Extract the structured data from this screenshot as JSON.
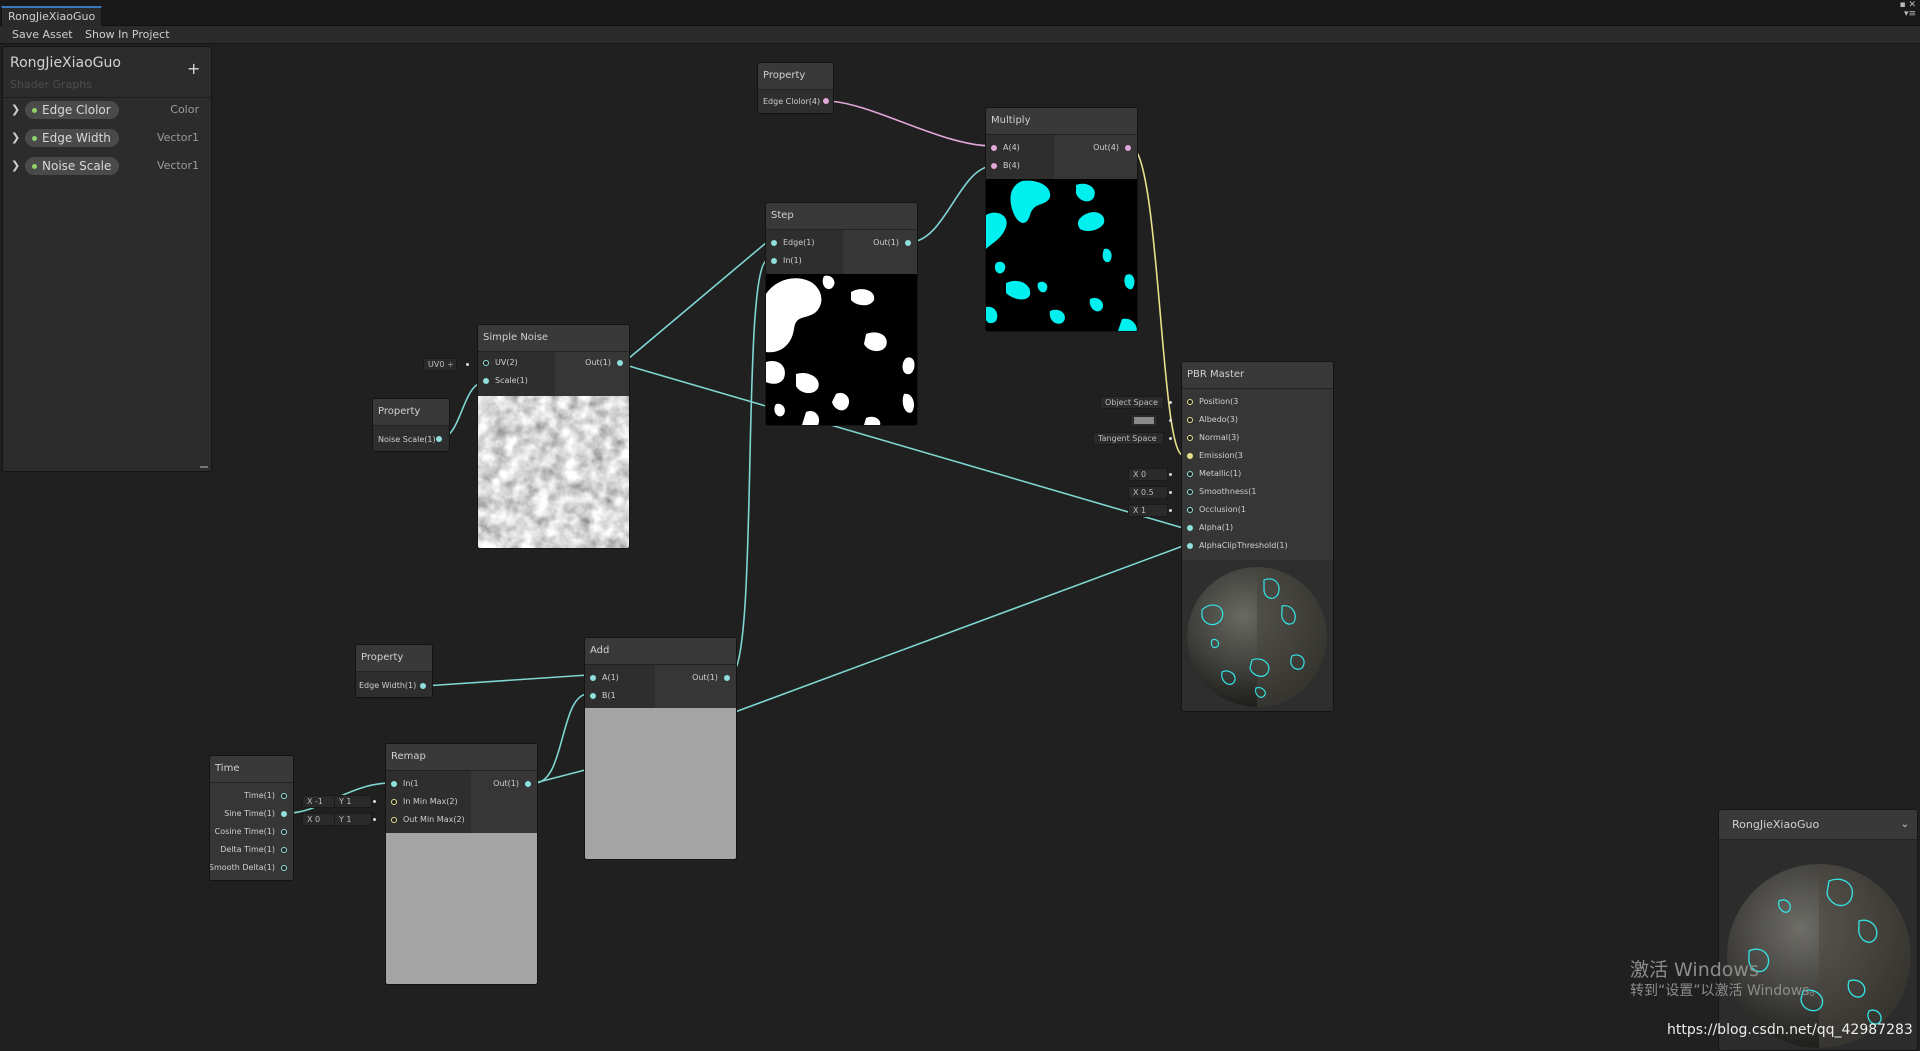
{
  "window": {
    "tab_title": "RongJieXiaoGuo",
    "window_controls": "▪ ✕\n▾≡"
  },
  "toolbar": {
    "save_asset": "Save Asset",
    "show_in_project": "Show In Project"
  },
  "blackboard": {
    "title": "RongJieXiaoGuo",
    "subtitle": "Shader Graphs",
    "add_label": "+",
    "properties": [
      {
        "name": "Edge Clolor",
        "type": "Color"
      },
      {
        "name": "Edge Width",
        "type": "Vector1"
      },
      {
        "name": "Noise Scale",
        "type": "Vector1"
      }
    ]
  },
  "nodes": {
    "prop_edge_color": {
      "title": "Property",
      "output": "Edge Clolor(4)"
    },
    "prop_noise_scale": {
      "title": "Property",
      "output": "Noise Scale(1)"
    },
    "prop_edge_width": {
      "title": "Property",
      "output": "Edge Width(1)"
    },
    "simple_noise": {
      "title": "Simple Noise",
      "inputs": [
        "UV(2)",
        "Scale(1)"
      ],
      "output": "Out(1)",
      "uv_default": "UV0 ÷"
    },
    "step": {
      "title": "Step",
      "inputs": [
        "Edge(1)",
        "In(1)"
      ],
      "output": "Out(1)"
    },
    "multiply": {
      "title": "Multiply",
      "inputs": [
        "A(4)",
        "B(4)"
      ],
      "output": "Out(4)"
    },
    "add": {
      "title": "Add",
      "inputs": [
        "A(1)",
        "B(1"
      ],
      "output": "Out(1)"
    },
    "remap": {
      "title": "Remap",
      "inputs": [
        "In(1",
        "In Min Max(2)",
        "Out Min Max(2)"
      ],
      "output": "Out(1)",
      "in_min_max": {
        "x": "X -1",
        "y": "Y 1"
      },
      "out_min_max": {
        "x": "X 0",
        "y": "Y 1"
      }
    },
    "time": {
      "title": "Time",
      "outputs": [
        "Time(1)",
        "Sine Time(1)",
        "Cosine Time(1)",
        "Delta Time(1)",
        "Smooth Delta(1)"
      ]
    },
    "pbr_master": {
      "title": "PBR Master",
      "inputs": [
        "Position(3",
        "Albedo(3)",
        "Normal(3)",
        "Emission(3",
        "Metallic(1)",
        "Smoothness(1",
        "Occlusion(1",
        "Alpha(1)",
        "AlphaClipThreshold(1)"
      ],
      "defaults": {
        "position": "Object Space",
        "normal": "Tangent Space",
        "metallic": "X 0",
        "smoothness": "X 0.5",
        "occlusion": "X 1"
      }
    }
  },
  "main_preview": {
    "title": "RongJieXiaoGuo",
    "chevron": "⌄"
  },
  "watermark": {
    "line1": "激活 Windows",
    "line2": "转到“设置”以激活 Windows。",
    "url": "https://blog.csdn.net/qq_42987283"
  },
  "colors": {
    "wire_float": "#7fd6d2",
    "wire_color": "#e1a7d8",
    "wire_vector3": "#e8e08a",
    "edge_cyan": "#00f0f0"
  }
}
